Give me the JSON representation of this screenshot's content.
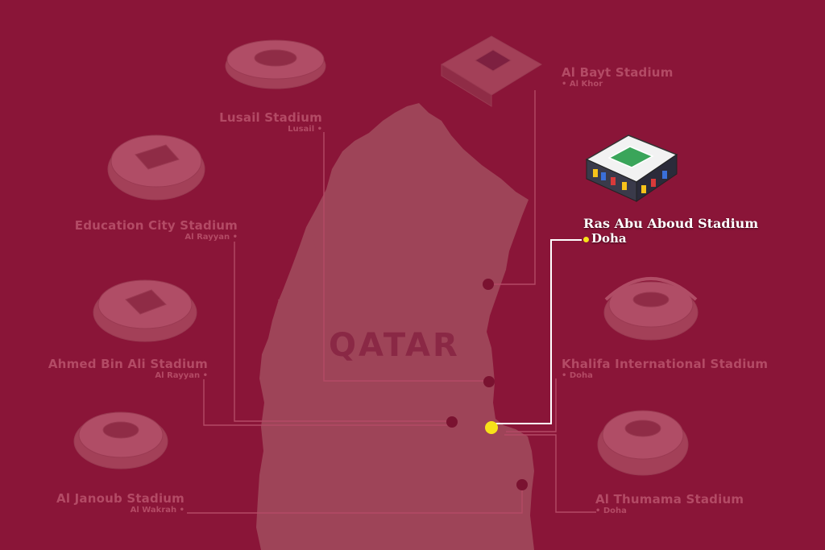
{
  "country_label": "QATAR",
  "colors": {
    "background": "#8a1538",
    "land": "#9e4458",
    "faded_text": "#b34a65",
    "highlight_dot": "#f7e21a",
    "highlight_text": "#ffffff"
  },
  "stadiums": [
    {
      "name": "Lusail Stadium",
      "city": "Lusail",
      "highlighted": false
    },
    {
      "name": "Al Bayt Stadium",
      "city": "Al Khor",
      "highlighted": false
    },
    {
      "name": "Education City Stadium",
      "city": "Al Rayyan",
      "highlighted": false
    },
    {
      "name": "Ras Abu Aboud Stadium",
      "city": "Doha",
      "highlighted": true
    },
    {
      "name": "Ahmed Bin Ali Stadium",
      "city": "Al Rayyan",
      "highlighted": false
    },
    {
      "name": "Khalifa International Stadium",
      "city": "Doha",
      "highlighted": false
    },
    {
      "name": "Al Janoub Stadium",
      "city": "Al Wakrah",
      "highlighted": false
    },
    {
      "name": "Al Thumama Stadium",
      "city": "Doha",
      "highlighted": false
    }
  ]
}
